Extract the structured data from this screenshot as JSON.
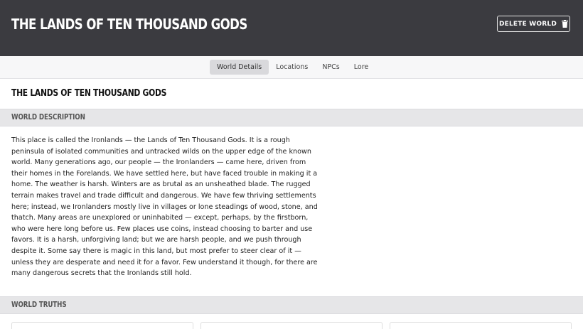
{
  "header": {
    "title": "THE LANDS OF TEN THOUSAND GODS",
    "delete_label": "DELETE WORLD",
    "delete_icon": "trash-icon"
  },
  "tabs": [
    {
      "label": "World Details",
      "active": true
    },
    {
      "label": "Locations",
      "active": false
    },
    {
      "label": "NPCs",
      "active": false
    },
    {
      "label": "Lore",
      "active": false
    }
  ],
  "world": {
    "name": "THE LANDS OF TEN THOUSAND GODS"
  },
  "sections": {
    "description_title": "WORLD DESCRIPTION",
    "description_text": "This place is called the Ironlands — the Lands of Ten Thousand Gods. It is a rough peninsula of isolated communities and untracked wilds on the upper edge of the known world. Many generations ago, our people — the Ironlanders — came here, driven from their homes in the Forelands. We have settled here, but have faced trouble in making it a home. The weather is harsh. Winters are as brutal as an unsheathed blade. The rugged terrain makes travel and trade difficult and dangerous. We have few thriving settlements here; instead, we Ironlanders mostly live in villages or lone steadings of wood, stone, and thatch. Many areas are unexplored or uninhabited — except, perhaps, by the firstborn, who were here long before us. Few places use coins, instead choosing to barter and use favors. It is a harsh, unforgiving land; but we are harsh people, and we push through despite it. Some say there is magic in this land, but most prefer to steer clear of it — unless they are desperate and need it for a favor. Few understand it though, for there are many dangerous secrets that the Ironlands still hold.",
    "truths_title": "WORLD TRUTHS"
  },
  "colors": {
    "header_bg": "#3b3b40",
    "section_bg": "#e6e6e8",
    "active_tab_bg": "#d9d9dc"
  }
}
